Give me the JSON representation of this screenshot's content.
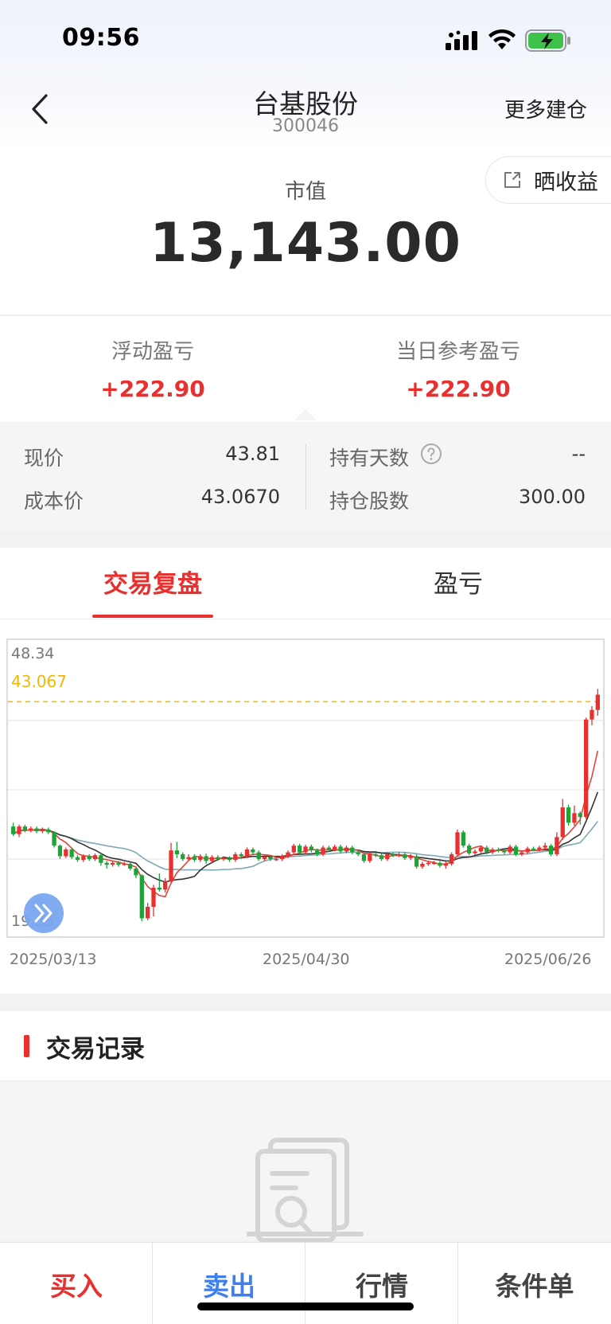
{
  "status_bar": {
    "time": "09:56"
  },
  "nav": {
    "title": "台基股份",
    "code": "300046",
    "more_label": "更多建仓"
  },
  "share": {
    "label": "晒收益"
  },
  "market_value": {
    "label": "市值",
    "value": "13,143.00"
  },
  "pnl": {
    "floating_label": "浮动盈亏",
    "floating_value": "+222.90",
    "daily_label": "当日参考盈亏",
    "daily_value": "+222.90"
  },
  "stats": {
    "price_label": "现价",
    "price_value": "43.81",
    "cost_label": "成本价",
    "cost_value": "43.0670",
    "days_label": "持有天数",
    "days_value": "--",
    "shares_label": "持仓股数",
    "shares_value": "300.00"
  },
  "tabs": [
    {
      "label": "交易复盘",
      "active": true
    },
    {
      "label": "盈亏",
      "active": false
    }
  ],
  "chart": {
    "y_max_label": "48.34",
    "ref_line_label": "43.067",
    "y_min_label": "19.35",
    "x_labels": [
      "2025/03/13",
      "2025/04/30",
      "2025/06/26"
    ]
  },
  "chart_data": {
    "type": "candlestick",
    "title": "",
    "y_range": [
      19.35,
      48.34
    ],
    "reference_line": {
      "label": "43.067",
      "value": 43.067
    },
    "x_ticks": [
      "2025/03/13",
      "2025/04/30",
      "2025/06/26"
    ],
    "candles": [
      [
        30.0,
        29.2,
        30.4,
        29.0
      ],
      [
        29.2,
        30.0,
        30.2,
        28.9
      ],
      [
        30.0,
        29.6,
        30.2,
        29.4
      ],
      [
        29.6,
        29.8,
        30.0,
        29.4
      ],
      [
        29.8,
        29.5,
        30.0,
        29.3
      ],
      [
        29.5,
        29.7,
        29.9,
        29.3
      ],
      [
        29.7,
        29.4,
        29.9,
        29.2
      ],
      [
        29.4,
        28.0,
        29.5,
        27.8
      ],
      [
        28.0,
        26.9,
        28.1,
        26.6
      ],
      [
        26.9,
        27.6,
        27.8,
        26.7
      ],
      [
        27.6,
        26.8,
        27.8,
        26.6
      ],
      [
        26.8,
        26.5,
        27.0,
        26.3
      ],
      [
        26.5,
        26.9,
        27.1,
        26.3
      ],
      [
        26.9,
        26.6,
        27.1,
        26.4
      ],
      [
        26.6,
        27.0,
        27.2,
        26.4
      ],
      [
        27.0,
        26.2,
        27.2,
        25.9
      ],
      [
        26.2,
        26.0,
        26.4,
        25.6
      ],
      [
        26.0,
        26.2,
        26.4,
        25.8
      ],
      [
        26.2,
        26.0,
        26.4,
        25.8
      ],
      [
        26.0,
        26.1,
        26.3,
        25.9
      ],
      [
        26.1,
        25.6,
        26.3,
        25.4
      ],
      [
        25.6,
        24.9,
        25.8,
        24.6
      ],
      [
        24.9,
        20.4,
        25.0,
        20.1
      ],
      [
        20.4,
        21.6,
        22.0,
        20.2
      ],
      [
        21.6,
        23.6,
        23.9,
        20.6
      ],
      [
        23.6,
        23.4,
        25.1,
        23.2
      ],
      [
        23.4,
        24.3,
        24.6,
        23.1
      ],
      [
        24.3,
        27.5,
        28.3,
        24.1
      ],
      [
        27.5,
        27.1,
        28.4,
        26.7
      ],
      [
        27.1,
        26.6,
        27.3,
        26.4
      ],
      [
        26.6,
        26.8,
        27.1,
        26.4
      ],
      [
        26.8,
        26.5,
        27.1,
        26.3
      ],
      [
        26.5,
        26.9,
        27.1,
        26.3
      ],
      [
        26.9,
        26.4,
        27.2,
        26.1
      ],
      [
        26.4,
        26.8,
        27.0,
        26.2
      ],
      [
        26.8,
        26.6,
        27.0,
        26.4
      ],
      [
        26.6,
        26.7,
        26.9,
        26.4
      ],
      [
        26.7,
        26.5,
        26.9,
        26.3
      ],
      [
        26.5,
        27.1,
        27.3,
        26.3
      ],
      [
        27.1,
        26.9,
        27.3,
        26.6
      ],
      [
        26.9,
        27.6,
        27.8,
        26.7
      ],
      [
        27.6,
        27.3,
        27.8,
        27.1
      ],
      [
        27.3,
        26.6,
        27.5,
        26.4
      ],
      [
        26.6,
        26.8,
        27.0,
        26.4
      ],
      [
        26.8,
        26.6,
        27.0,
        26.4
      ],
      [
        26.6,
        26.6,
        26.8,
        26.4
      ],
      [
        26.6,
        26.9,
        27.1,
        26.4
      ],
      [
        26.9,
        27.3,
        27.5,
        26.7
      ],
      [
        27.3,
        28.0,
        28.2,
        27.1
      ],
      [
        28.0,
        27.3,
        28.2,
        27.1
      ],
      [
        27.3,
        27.9,
        28.1,
        27.1
      ],
      [
        27.9,
        27.5,
        28.1,
        27.3
      ],
      [
        27.5,
        27.1,
        27.7,
        26.9
      ],
      [
        27.1,
        27.8,
        28.0,
        26.9
      ],
      [
        27.8,
        27.6,
        28.0,
        27.4
      ],
      [
        27.6,
        27.9,
        28.1,
        27.4
      ],
      [
        27.9,
        27.4,
        28.1,
        27.2
      ],
      [
        27.4,
        27.8,
        28.0,
        27.2
      ],
      [
        27.8,
        27.3,
        28.0,
        27.1
      ],
      [
        27.3,
        27.1,
        27.5,
        26.9
      ],
      [
        27.1,
        26.4,
        27.3,
        26.2
      ],
      [
        26.4,
        27.1,
        27.3,
        26.2
      ],
      [
        27.1,
        27.0,
        27.3,
        26.8
      ],
      [
        27.0,
        26.6,
        27.2,
        26.4
      ],
      [
        26.6,
        27.1,
        27.3,
        26.4
      ],
      [
        27.1,
        27.0,
        27.3,
        26.8
      ],
      [
        27.0,
        27.1,
        27.3,
        26.8
      ],
      [
        27.1,
        26.7,
        27.3,
        26.5
      ],
      [
        26.7,
        26.9,
        27.1,
        26.5
      ],
      [
        26.9,
        25.8,
        27.1,
        25.6
      ],
      [
        25.8,
        26.1,
        26.3,
        25.6
      ],
      [
        26.1,
        26.2,
        26.4,
        25.9
      ],
      [
        26.2,
        26.2,
        26.4,
        26.0
      ],
      [
        26.2,
        25.9,
        26.4,
        25.7
      ],
      [
        25.9,
        26.1,
        26.3,
        25.6
      ],
      [
        26.1,
        27.1,
        27.3,
        25.9
      ],
      [
        27.1,
        29.4,
        29.7,
        26.9
      ],
      [
        29.4,
        28.0,
        29.6,
        27.8
      ],
      [
        28.0,
        27.2,
        28.2,
        27.0
      ],
      [
        27.2,
        27.4,
        27.6,
        27.0
      ],
      [
        27.4,
        27.8,
        28.0,
        27.2
      ],
      [
        27.8,
        27.3,
        28.0,
        27.1
      ],
      [
        27.3,
        27.6,
        27.8,
        27.1
      ],
      [
        27.6,
        27.5,
        27.8,
        27.3
      ],
      [
        27.5,
        27.3,
        27.7,
        27.1
      ],
      [
        27.3,
        27.9,
        28.1,
        27.1
      ],
      [
        27.9,
        27.1,
        28.1,
        26.9
      ],
      [
        27.1,
        27.3,
        27.5,
        26.9
      ],
      [
        27.3,
        27.7,
        27.9,
        27.1
      ],
      [
        27.7,
        27.6,
        27.9,
        27.4
      ],
      [
        27.6,
        27.8,
        28.0,
        27.4
      ],
      [
        27.8,
        28.0,
        28.3,
        27.6
      ],
      [
        28.0,
        27.1,
        28.2,
        26.9
      ],
      [
        27.1,
        28.9,
        29.4,
        26.9
      ],
      [
        28.9,
        32.0,
        32.9,
        28.6
      ],
      [
        32.0,
        30.4,
        32.3,
        30.1
      ],
      [
        30.4,
        31.4,
        32.2,
        30.1
      ],
      [
        31.4,
        31.0,
        31.6,
        30.2
      ],
      [
        31.0,
        41.2,
        41.4,
        30.8
      ],
      [
        41.2,
        42.2,
        42.6,
        40.6
      ],
      [
        42.2,
        43.8,
        44.4,
        41.6
      ]
    ]
  },
  "records": {
    "title": "交易记录"
  },
  "bottom_bar": {
    "buy": "买入",
    "sell": "卖出",
    "quote": "行情",
    "conditional": "条件单"
  },
  "colors": {
    "up": "#e8302f",
    "down": "#1fa338",
    "accent_blue": "#3d7ff0",
    "ref_line": "#f2c200",
    "ma5": "#e0463a",
    "ma10": "#333333",
    "ma20": "#7fa9b4"
  }
}
